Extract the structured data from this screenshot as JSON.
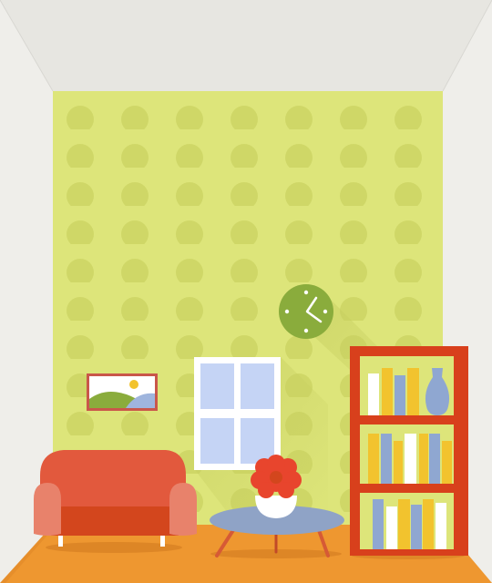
{
  "scene": {
    "description_free": true,
    "palette": {
      "ceiling": "#e7e6e1",
      "side_wall": "#efeeea",
      "back_wall": "#dde57a",
      "polka_dot": "#cfd767",
      "floor": "#ee9730",
      "floor_edge": "#d67f22",
      "sofa": "#e2593d",
      "sofa_seat": "#d3461d",
      "sofa_arm": "#e8826b",
      "window_frame": "#ffffff",
      "window_glass": "#c5d4f5",
      "clock": "#8aac3c",
      "table_top": "#8fa3c6",
      "table_legs": "#d65a35",
      "flower": "#e8452d",
      "bookshelf": "#d8401c",
      "book_yellow": "#f2c32e",
      "book_blue": "#8fa7d1",
      "book_white": "#ffffff",
      "picture_frame": "#c9574a",
      "picture_sky": "#ffffff",
      "picture_hill": "#8aac3c",
      "picture_water": "#9fb5dd",
      "picture_sun": "#f2c32e"
    },
    "icons": [
      "wall-clock-icon",
      "framed-landscape-icon",
      "vase-icon",
      "flower-pot-icon"
    ]
  }
}
